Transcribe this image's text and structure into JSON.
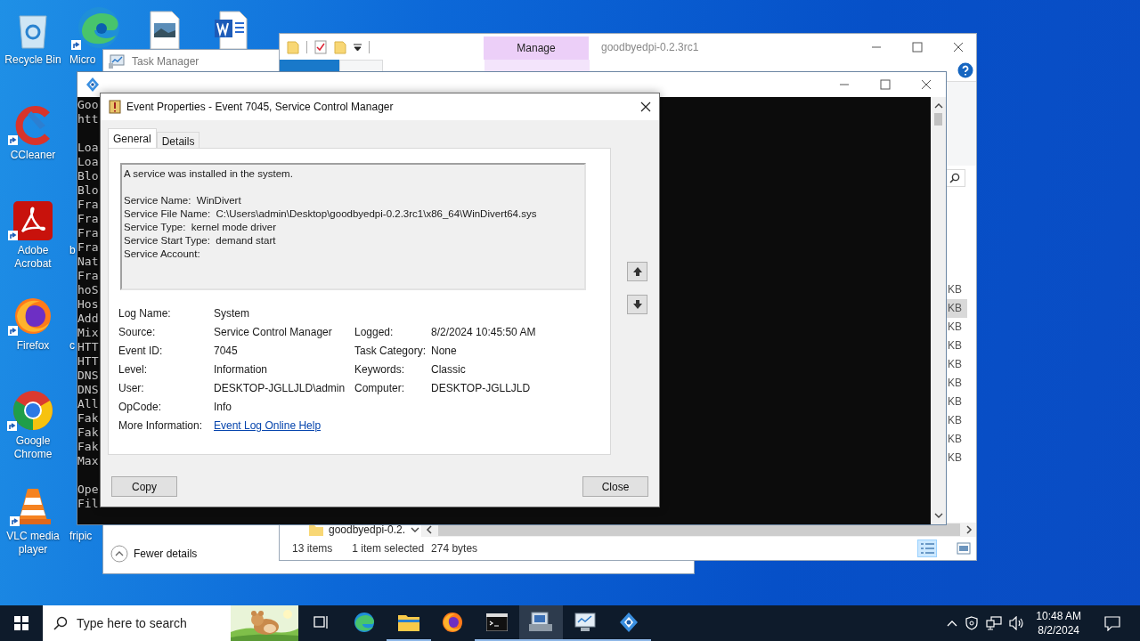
{
  "desktop_icons": [
    {
      "kind": "recycle",
      "label": "Recycle Bin",
      "shortcut": false
    },
    {
      "kind": "ccleaner",
      "label": "CCleaner",
      "shortcut": true
    },
    {
      "kind": "acrobat",
      "label": "Adobe Acrobat",
      "shortcut": true
    },
    {
      "kind": "firefox",
      "label": "Firefox",
      "shortcut": true
    },
    {
      "kind": "chrome",
      "label": "Google Chrome",
      "shortcut": true
    },
    {
      "kind": "vlc",
      "label": "VLC media player",
      "shortcut": true
    },
    {
      "kind": "edge",
      "label": "Micro",
      "shortcut": true
    },
    {
      "kind": "hidden",
      "label": "b"
    },
    {
      "kind": "hidden",
      "label": "c"
    },
    {
      "kind": "hidden",
      "label": "fripic"
    },
    {
      "kind": "image-file",
      "shortcut": false
    },
    {
      "kind": "word-file",
      "shortcut": false
    }
  ],
  "task_manager": {
    "title": "Task Manager",
    "details_toggle": "Fewer details"
  },
  "explorer": {
    "title": "goodbyedpi-0.2.3rc1",
    "context_tab": "Manage",
    "nav_item": "goodbyedpi-0.2.",
    "sizes": [
      {
        "text": "KB",
        "selected": false
      },
      {
        "text": "KB",
        "selected": true
      },
      {
        "text": "KB",
        "selected": false
      },
      {
        "text": "KB",
        "selected": false
      },
      {
        "text": "KB",
        "selected": false
      },
      {
        "text": "KB",
        "selected": false
      },
      {
        "text": "KB",
        "selected": false
      },
      {
        "text": "KB",
        "selected": false
      },
      {
        "text": "KB",
        "selected": false
      },
      {
        "text": "KB",
        "selected": false
      }
    ],
    "status": {
      "count": "13 items",
      "selection": "1 item selected",
      "size": "274 bytes"
    }
  },
  "console": {
    "blocks": [
      [
        "Goo",
        "htt"
      ],
      [
        "Loa",
        "Loa",
        "Blo",
        "Blo",
        "Fra",
        "Fra",
        "Fra",
        "Fra",
        "Nat",
        "Fra",
        "hoS",
        "Hos",
        "Add",
        "Mix",
        "HTT",
        "HTT",
        "DNS",
        "DNS",
        "All",
        "Fak",
        "Fak",
        "Fak",
        "Max"
      ],
      [
        "Ope",
        "Fil"
      ]
    ]
  },
  "dialog": {
    "title": "Event Properties - Event 7045, Service Control Manager",
    "tabs": [
      {
        "label": "General",
        "selected": true
      },
      {
        "label": "Details",
        "selected": false
      }
    ],
    "description": "A service was installed in the system.\n\nService Name:  WinDivert\nService File Name:  C:\\Users\\admin\\Desktop\\goodbyedpi-0.2.3rc1\\x86_64\\WinDivert64.sys\nService Type:  kernel mode driver\nService Start Type:  demand start\nService Account:",
    "rows": [
      {
        "label": "Log Name:",
        "value": "System"
      },
      {
        "label": "Source:",
        "value": "Service Control Manager",
        "label_2": "Logged:",
        "value_2": "8/2/2024 10:45:50 AM"
      },
      {
        "label": "Event ID:",
        "value": "7045",
        "label_2": "Task Category:",
        "value_2": "None"
      },
      {
        "label": "Level:",
        "value": "Information",
        "label_2": "Keywords:",
        "value_2": "Classic"
      },
      {
        "label": "User:",
        "value": "DESKTOP-JGLLJLD\\admin",
        "label_2": "Computer:",
        "value_2": "DESKTOP-JGLLJLD"
      },
      {
        "label": "OpCode:",
        "value": "Info"
      },
      {
        "label": "More Information:",
        "link": "Event Log Online Help"
      }
    ],
    "buttons": [
      "Copy",
      "Close"
    ]
  },
  "taskbar": {
    "search_placeholder": "Type here to search",
    "apps": [
      {
        "kind": "taskview",
        "running": false,
        "selected": false
      },
      {
        "kind": "edge",
        "running": false,
        "selected": false
      },
      {
        "kind": "folder",
        "running": true,
        "selected": false
      },
      {
        "kind": "firefox",
        "running": false,
        "selected": false
      },
      {
        "kind": "terminal",
        "running": true,
        "selected": false
      },
      {
        "kind": "event-viewer",
        "running": true,
        "selected": true
      },
      {
        "kind": "monitor",
        "running": true,
        "selected": false
      },
      {
        "kind": "gear",
        "running": true,
        "selected": false
      }
    ],
    "time": "10:48 AM",
    "date": "8/2/2024"
  }
}
